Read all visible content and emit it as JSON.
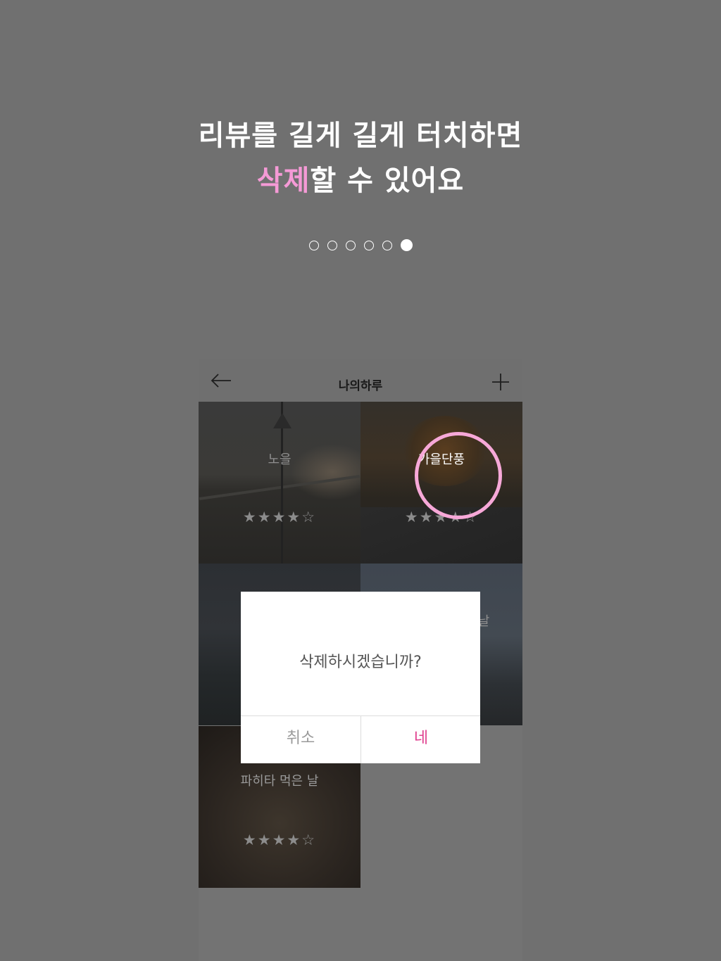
{
  "headline": {
    "line1": "리뷰를 길게 길게 터치하면",
    "line2_accent": "삭제",
    "line2_rest": "할 수 있어요"
  },
  "pager": {
    "total": 6,
    "active_index": 5
  },
  "app": {
    "title": "나의하루",
    "back_icon": "arrow-left-icon",
    "add_icon": "plus-icon"
  },
  "reviews": [
    {
      "title": "노을",
      "rating": 4,
      "stars": "★★★★☆"
    },
    {
      "title": "가을단풍",
      "rating": 4,
      "stars": "★★★★☆"
    },
    {
      "title": "",
      "rating": 0,
      "stars": ""
    },
    {
      "title": "날",
      "rating": 0,
      "stars": ""
    },
    {
      "title": "파히타 먹은 날",
      "rating": 4,
      "stars": "★★★★☆"
    }
  ],
  "dialog": {
    "message": "삭제하시겠습니까?",
    "cancel_label": "취소",
    "confirm_label": "네"
  },
  "colors": {
    "overlay": "#707070",
    "accent_pink": "#f59ad6",
    "confirm_pink": "#e0408f",
    "highlight_ring": "#f7a8d8"
  }
}
